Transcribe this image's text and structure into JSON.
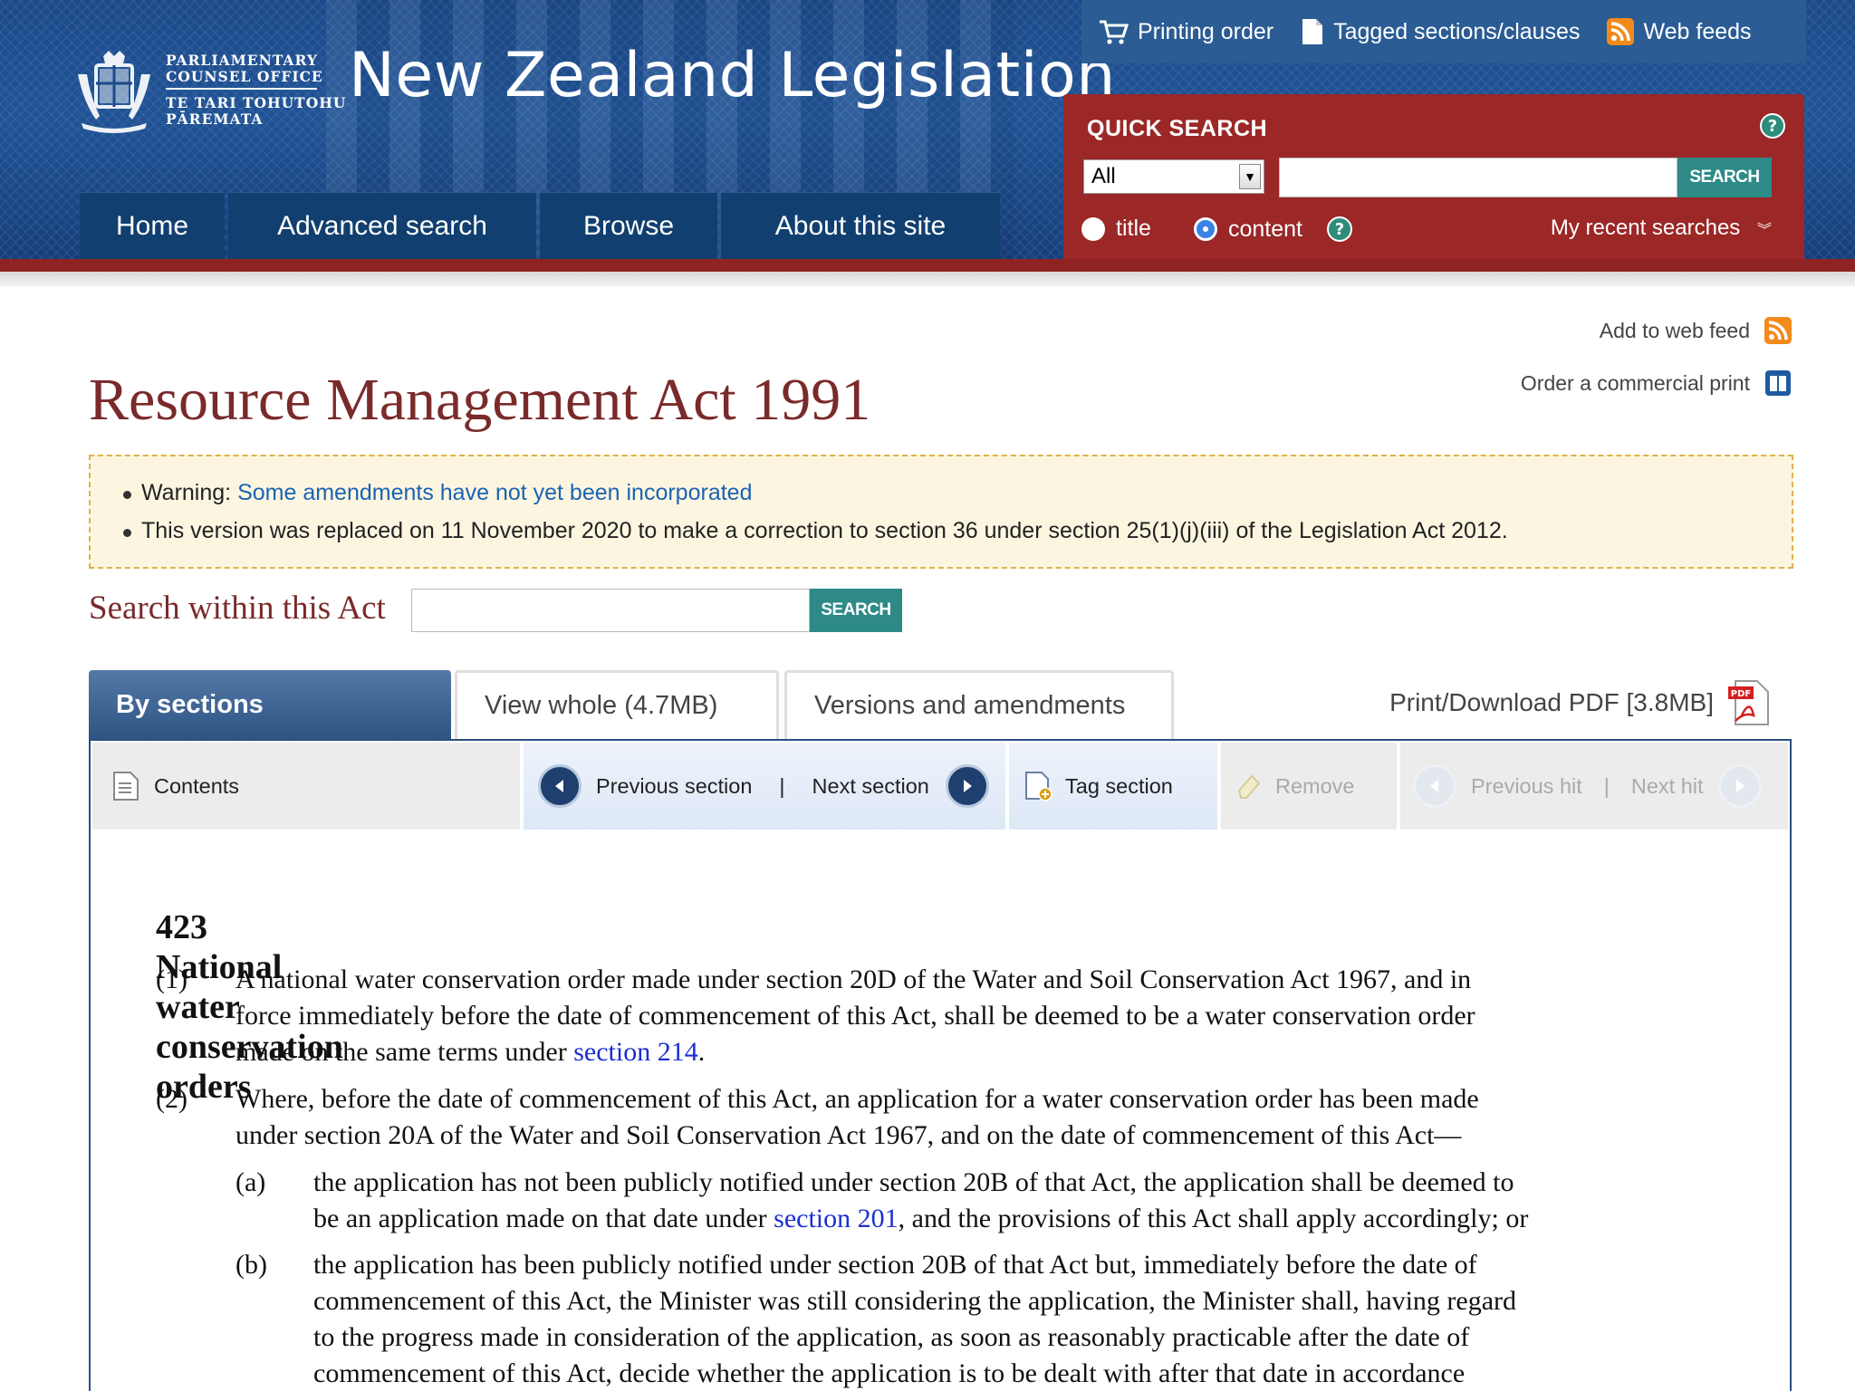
{
  "header": {
    "org_line1": "PARLIAMENTARY",
    "org_line2": "COUNSEL OFFICE",
    "org_line3": "TE TARI TOHUTOHU",
    "org_line4": "PĀREMATA",
    "site_title": "New Zealand Legislation",
    "nav": [
      "Home",
      "Advanced search",
      "Browse",
      "About this site"
    ],
    "util_links": {
      "printing_order": "Printing order",
      "tagged": "Tagged sections/clauses",
      "web_feeds": "Web feeds"
    },
    "quick_search": {
      "title": "QUICK SEARCH",
      "scope_selected": "All",
      "button": "SEARCH",
      "radio_title": "title",
      "radio_content": "content",
      "radio_selected": "content",
      "recent": "My recent searches"
    }
  },
  "page": {
    "add_feed": "Add to web feed",
    "order_print": "Order a commercial print",
    "title": "Resource Management Act 1991",
    "notice": {
      "warning_label": "Warning:",
      "warning_link": "Some amendments have not yet been incorporated",
      "version_note": "This version was replaced on 11 November 2020 to make a correction to section 36 under section 25(1)(j)(iii) of the Legislation Act 2012."
    },
    "search_within": {
      "label": "Search within this Act",
      "button": "SEARCH"
    },
    "tabs": {
      "by_sections": "By sections",
      "view_whole": "View whole (4.7MB)",
      "versions": "Versions and amendments",
      "pdf": "Print/Download PDF [3.8MB]"
    },
    "toolbar": {
      "contents": "Contents",
      "previous_section": "Previous section",
      "separator": "|",
      "next_section": "Next section",
      "tag_section": "Tag section",
      "remove": "Remove",
      "previous_hit": "Previous hit",
      "next_hit": "Next hit"
    }
  },
  "section": {
    "number": "423",
    "heading": "National water conservation orders",
    "sub1": {
      "label": "(1)",
      "line1": "A national water conservation order made under section 20D of the Water and Soil Conservation Act 1967, and in",
      "line2": "force immediately before the date of commencement of this Act, shall be deemed to be a water conservation order",
      "line3_pre": "made on the same terms under ",
      "line3_link": "section 214",
      "line3_post": "."
    },
    "sub2": {
      "label": "(2)",
      "line1": "Where, before the date of commencement of this Act, an application for a water conservation order has been made",
      "line2": "under section 20A of the Water and Soil Conservation Act 1967, and on the date of commencement of this Act—"
    },
    "para_a": {
      "label": "(a)",
      "line1": "the application has not been publicly notified under section 20B of that Act, the application shall be deemed to",
      "line2_pre": "be an application made on that date under ",
      "line2_link": "section 201",
      "line2_post": ", and the provisions of this Act shall apply accordingly; or"
    },
    "para_b": {
      "label": "(b)",
      "line1": "the application has been publicly notified under section 20B of that Act but, immediately before the date of",
      "line2": "commencement of this Act, the Minister was still considering the application, the Minister shall, having regard",
      "line3": "to the progress made in consideration of the application, as soon as reasonably practicable after the date of",
      "line4": "commencement of this Act, decide whether the application is to be dealt with after that date in accordance"
    }
  },
  "colors": {
    "header_blue": "#1c4a8a",
    "nav_blue": "#113f6f",
    "quick_search_red": "#9b2727",
    "search_teal": "#2d8a87",
    "title_maroon": "#7a2a2a",
    "link_blue": "#1b2fd0",
    "notice_bg": "#fcf6e1"
  },
  "icons": [
    "crest-logo",
    "cart-icon",
    "document-icon",
    "rss-icon",
    "help-icon",
    "book-icon",
    "pdf-icon",
    "contents-icon",
    "arrow-left-icon",
    "arrow-right-icon",
    "tag-icon",
    "eraser-icon"
  ]
}
